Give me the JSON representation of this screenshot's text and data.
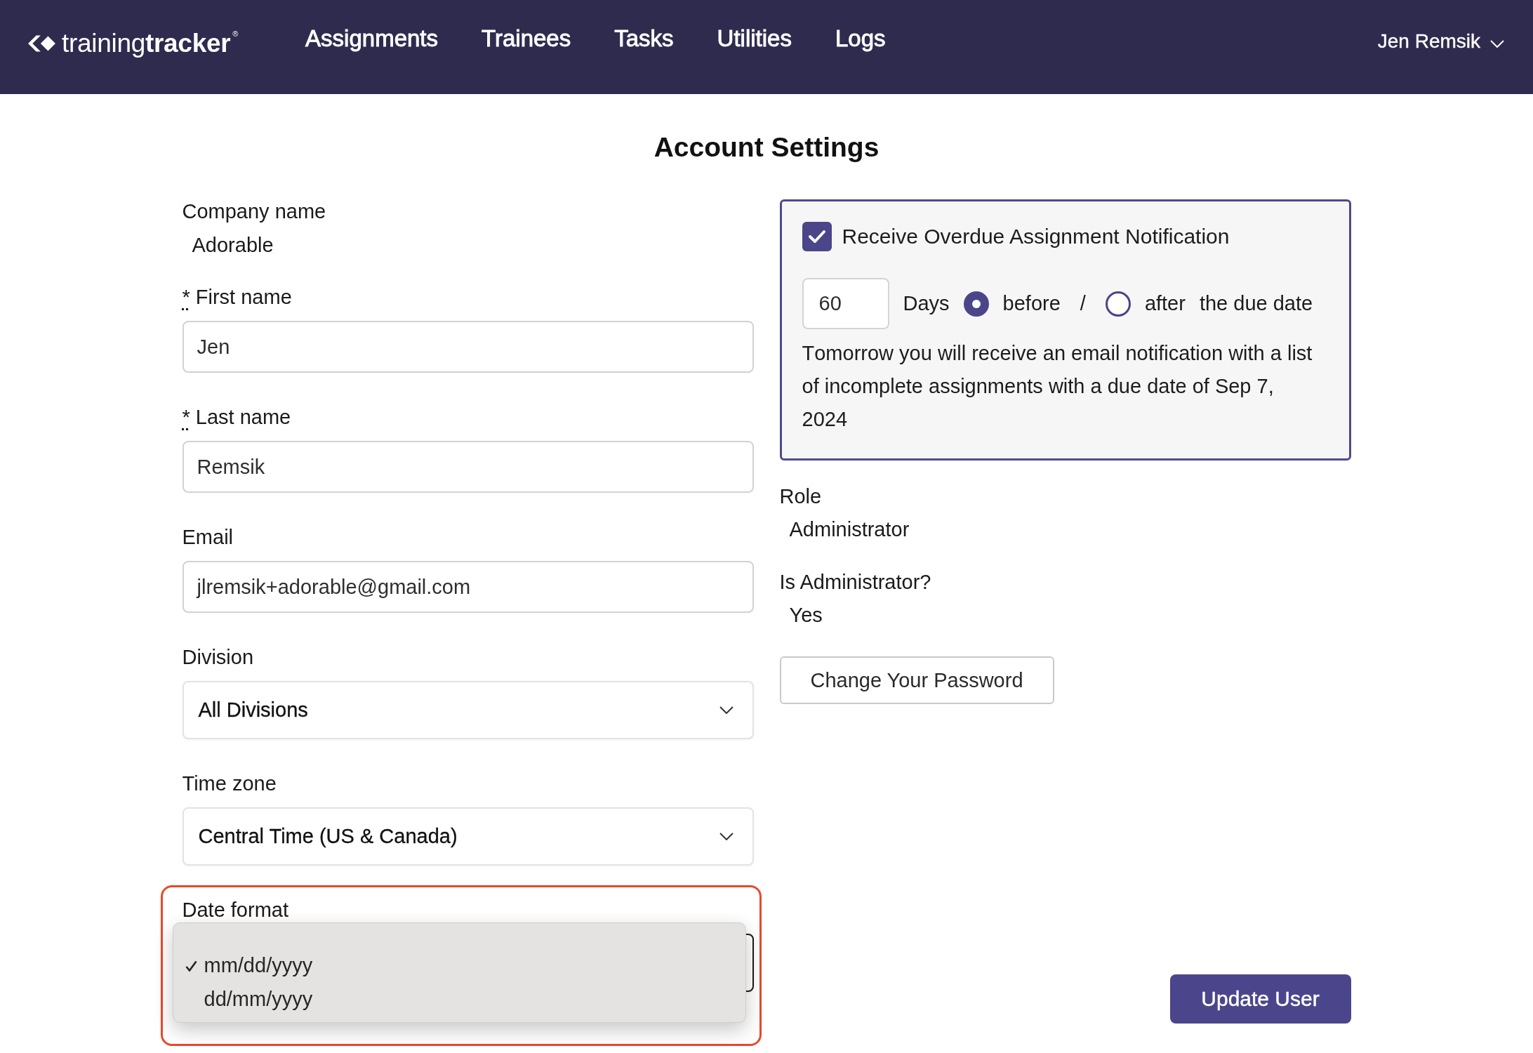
{
  "header": {
    "logo": "training**tracker**$^{®}$",
    "nav": [
      {
        "label": "Assignments",
        "selected": false
      },
      {
        "label": "Trainees",
        "selected": false
      },
      {
        "label": "Tasks",
        "selected": false
      },
      {
        "label": "Utilities",
        "selected": false
      },
      {
        "label": "Logs",
        "selected": false
      }
    ],
    "user": "Jen Remsik"
  },
  "title": "Account Settings",
  "form": {
    "company": {
      "label": "Company name",
      "value": "Adorable"
    },
    "fields": [
      {
        "kind": "text",
        "required_mark": "*",
        "label": "First name",
        "value": "Jen",
        "highlighted": false
      },
      {
        "kind": "text",
        "required_mark": "*",
        "label": "Last name",
        "value": "Remsik",
        "highlighted": false
      },
      {
        "kind": "text",
        "label": "Email",
        "value": "jlremsik+adorable@gmail.com",
        "highlighted": false
      },
      {
        "kind": "select",
        "label": "Division",
        "value": "All Divisions",
        "open": false,
        "highlighted": false
      },
      {
        "kind": "select",
        "label": "Time zone",
        "value": "Central Time (US & Canada)",
        "open": false,
        "highlighted": false
      },
      {
        "kind": "select",
        "label": "Date format",
        "open": true,
        "highlighted": true,
        "options": [
          {
            "label": "mm/dd/yyyy",
            "selected": true
          },
          {
            "label": "dd/mm/yyyy",
            "selected": false
          }
        ]
      }
    ]
  },
  "notification": {
    "label": "Receive Overdue Assignment Notification",
    "checked": true,
    "days_value": "60",
    "days_label": "Days",
    "options": [
      {
        "label": "before",
        "selected": true
      },
      {
        "label": "after",
        "selected": false
      }
    ],
    "separator": "/",
    "suffix": "the due date",
    "message": "Tomorrow you will receive an email notification with a list of incomplete assignments with a due date of Sep 7, 2024"
  },
  "details": [
    {
      "label": "Role",
      "value": "Administrator"
    },
    {
      "label": "Is Administrator?",
      "value": "Yes"
    }
  ],
  "buttons": {
    "change_password": "Change Your Password",
    "update": "Update User"
  }
}
